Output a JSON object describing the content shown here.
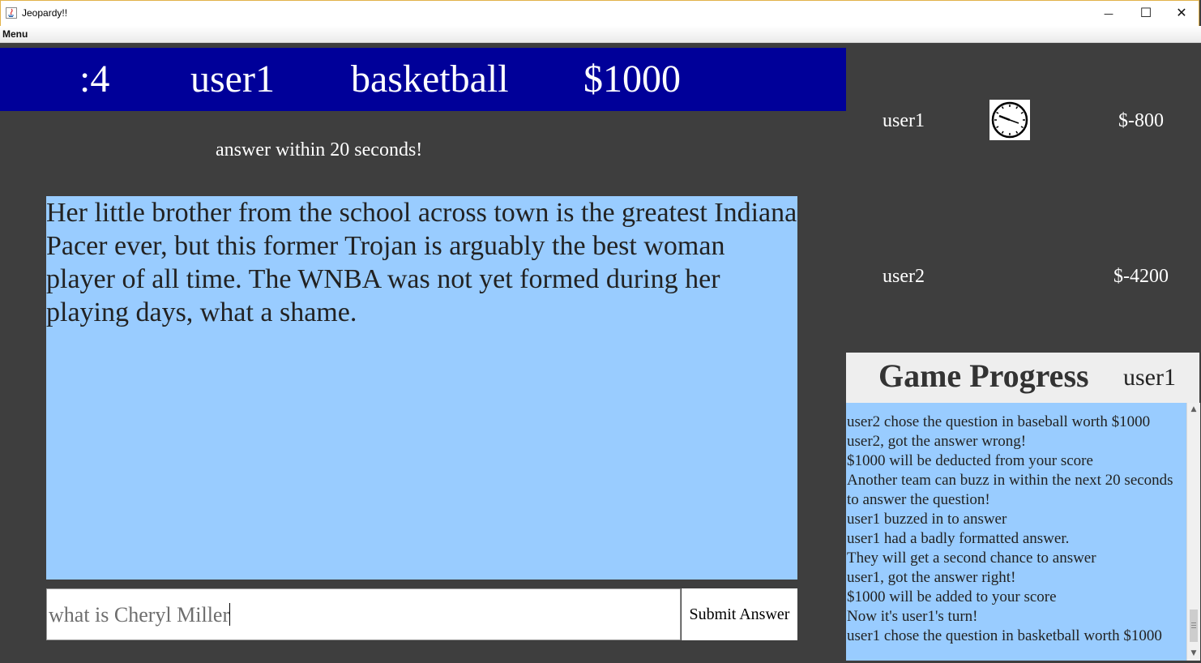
{
  "window": {
    "title": "Jeopardy!!",
    "minimize_glyph": "—",
    "maximize_glyph": "☐",
    "close_glyph": "✕"
  },
  "menu": {
    "label": "Menu"
  },
  "question_header": {
    "timer": ":4",
    "player": "user1",
    "category": "basketball",
    "value": "$1000"
  },
  "instruction": "answer within 20 seconds!",
  "question": {
    "text": "Her little brother from the school across town is the greatest Indiana Pacer ever, but this former Trojan is arguably the best woman player of all time. The WNBA was not yet formed during her playing days, what a shame."
  },
  "answer": {
    "value": "what is Cheryl Miller",
    "submit_label": "Submit Answer"
  },
  "players": [
    {
      "name": "user1",
      "score": "$-800",
      "active": true
    },
    {
      "name": "user2",
      "score": "$-4200",
      "active": false
    }
  ],
  "progress": {
    "title": "Game Progress",
    "current_user": "user1",
    "log": [
      "user2 chose the question in baseball worth $1000",
      "user2, got the answer wrong!",
      "$1000 will be deducted from your score",
      "Another team can buzz in within the next 20 seconds",
      "to answer the question!",
      "user1 buzzed in to answer",
      "user1 had a badly formatted answer.",
      "They will get a second chance to answer",
      "user1, got the answer right!",
      "$1000 will be added to your score",
      "Now it's user1's turn!",
      "user1 chose the question in basketball worth $1000"
    ]
  },
  "colors": {
    "background": "#3e3e3e",
    "header_blue": "#000099",
    "question_blue": "#99ccff"
  }
}
